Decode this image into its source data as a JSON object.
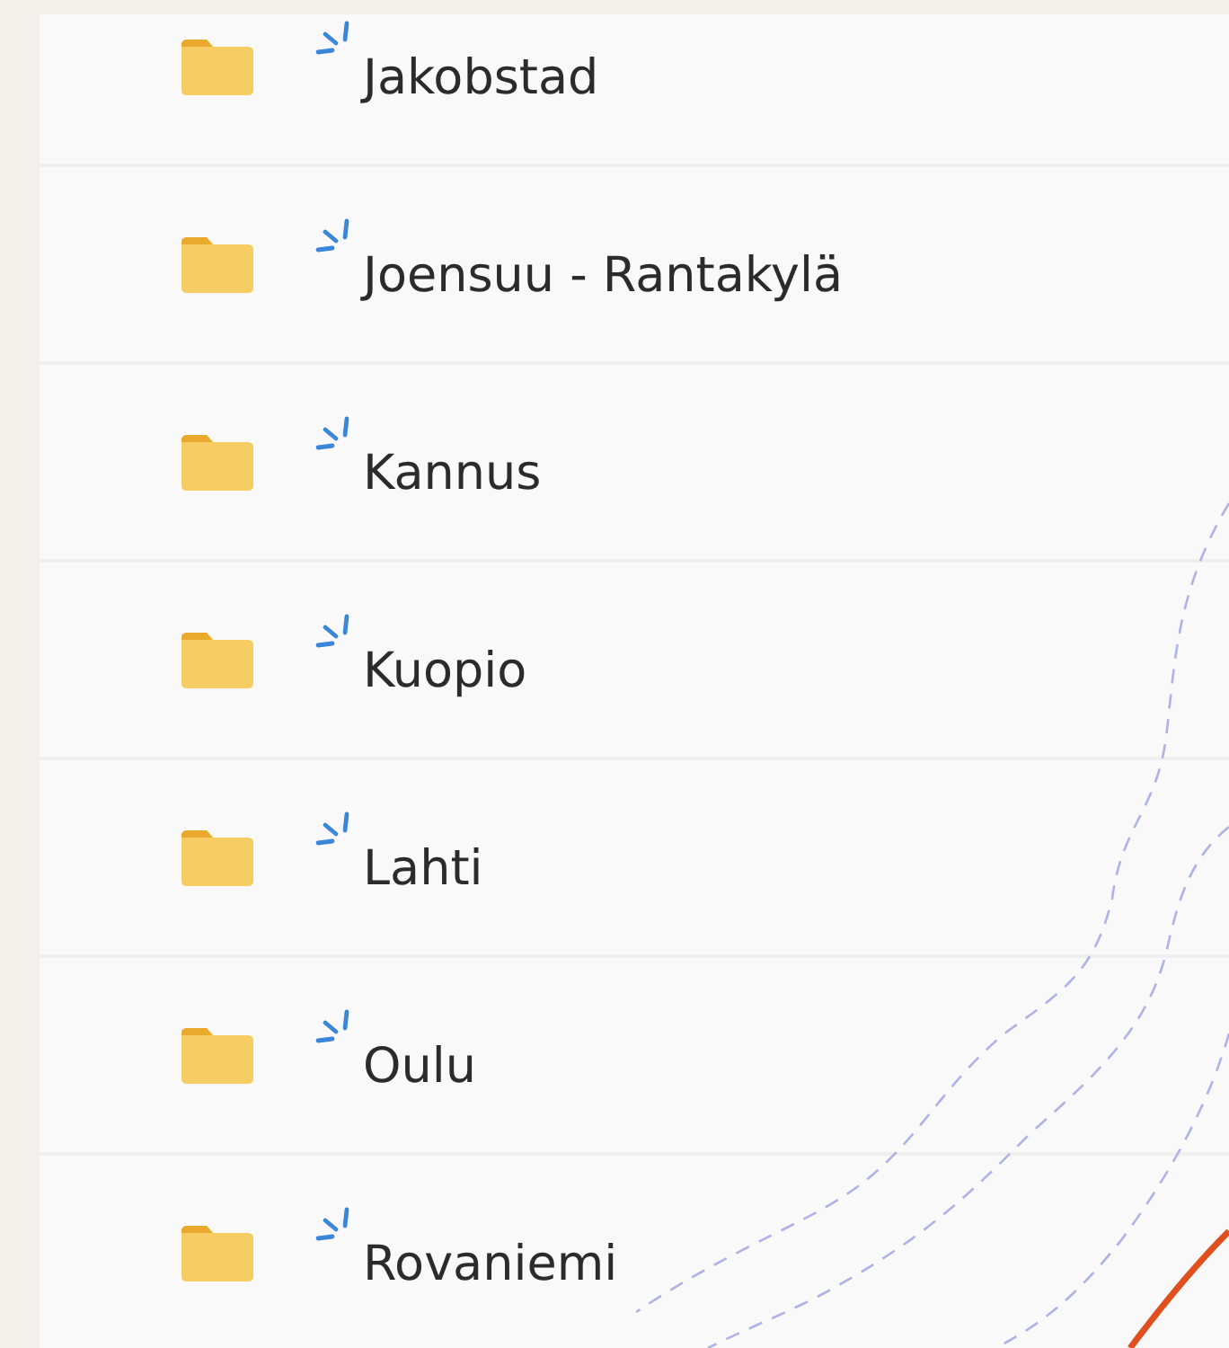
{
  "folders": [
    {
      "name": "Jakobstad",
      "new": true
    },
    {
      "name": "Joensuu - Rantakylä",
      "new": true
    },
    {
      "name": "Kannus",
      "new": true
    },
    {
      "name": "Kuopio",
      "new": true
    },
    {
      "name": "Lahti",
      "new": true
    },
    {
      "name": "Oulu",
      "new": true
    },
    {
      "name": "Rovaniemi",
      "new": true
    }
  ]
}
